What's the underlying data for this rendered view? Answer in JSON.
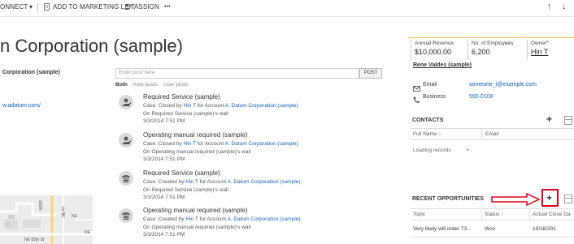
{
  "command_bar": {
    "connect_label": "ONNECT",
    "marketing_label": "ADD TO MARKETING LIST",
    "assign_label": "ASSIGN",
    "more_label": "•••",
    "up_arrow": "↑",
    "down_arrow": "↓"
  },
  "header": {
    "title": "n Corporation (sample)"
  },
  "left_column": {
    "parent_account": "Corporation (sample)",
    "website": "w.adatum.com/"
  },
  "post": {
    "placeholder": "Enter post here",
    "button_label": "POST",
    "filters": [
      "Both",
      "Auto posts",
      "User posts"
    ]
  },
  "feed": [
    {
      "title": "Required Service (sample)",
      "line1_prefix": "Case: Closed by ",
      "user": "Hin T",
      "line1_mid": " for Account ",
      "account": "A. Datum Corporation (sample).",
      "line2": "On Required Service (sample)'s wall",
      "date": "3/3/2014 7:51 PM",
      "icon": "closed-case-icon"
    },
    {
      "title": "Operating manual required (sample)",
      "line1_prefix": "Case: Closed by ",
      "user": "Hin T",
      "line1_mid": " for Account ",
      "account": "A. Datum Corporation (sample).",
      "line2": "On Operating manual required (sample)'s wall",
      "date": "3/3/2014 7:51 PM",
      "icon": "closed-case-icon"
    },
    {
      "title": "Required Service (sample)",
      "line1_prefix": "Case: Created by ",
      "user": "Hin T",
      "line1_mid": " for Account ",
      "account": "A. Datum Corporation (sample).",
      "line2": "On Required Service (sample)'s wall",
      "date": "3/3/2014 7:51 PM",
      "icon": "phone-case-icon"
    },
    {
      "title": "Operating manual required (sample)",
      "line1_prefix": "Case: Created by ",
      "user": "Hin T",
      "line1_mid": " for Account ",
      "account": "A. Datum Corporation (sample).",
      "line2": "On Operating manual required (sample)'s wall",
      "date": "3/3/2014 7:51 PM",
      "icon": "phone-case-icon"
    }
  ],
  "stats": {
    "annual_revenue_label": "Annual Revenue",
    "annual_revenue_value": "$10,000.00",
    "employees_label": "No. of Employees",
    "employees_value": "6,200",
    "owner_label": "Owner",
    "owner_required": "*",
    "owner_value": "Hin T"
  },
  "contact": {
    "name": "Rene Valdes (sample)",
    "email_label": "Email",
    "email_value": "someone_i@example.com",
    "business_label": "Business",
    "business_value": "555-0108"
  },
  "contacts_section": {
    "label": "CONTACTS",
    "columns": [
      "Full Name ↑",
      "Email"
    ],
    "loading": "Loading records",
    "loading_dot": "•"
  },
  "opportunities_section": {
    "label": "RECENT OPPORTUNITIES",
    "columns": [
      "Topic",
      "Status ↑",
      "Actual Close Da"
    ],
    "rows": [
      {
        "topic": "Very likely will order 73...",
        "status": "Won",
        "close_date": "10/18/201"
      }
    ]
  },
  "map": {
    "labels": [
      "NE",
      "NE",
      "NE 85th St",
      "160th",
      "ve NE"
    ]
  },
  "annotation_color": "#e0001b"
}
